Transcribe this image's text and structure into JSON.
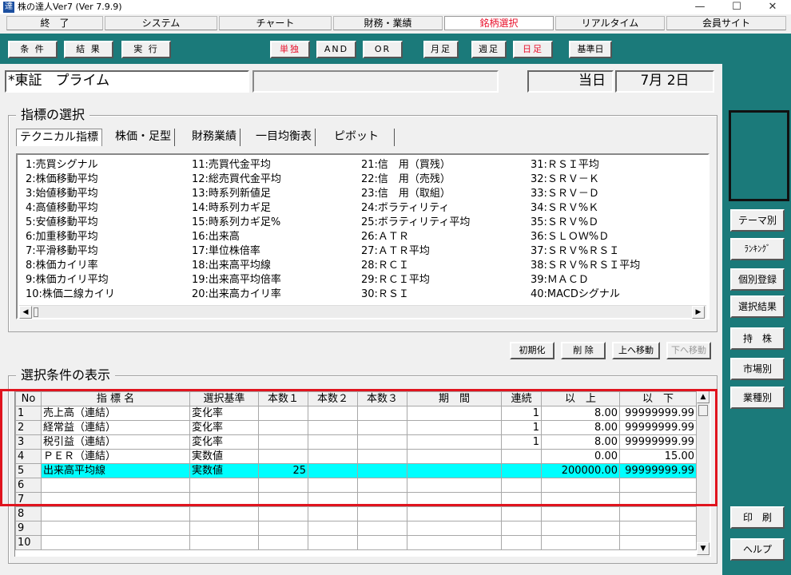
{
  "window": {
    "title": "株の達人Ver7 (Ver 7.9.9)",
    "app_icon_char": "達",
    "controls": [
      "—",
      "☐",
      "✕"
    ]
  },
  "menu": [
    "終　了",
    "システム",
    "チャート",
    "財務・業績",
    "銘柄選択",
    "リアルタイム",
    "会員サイト"
  ],
  "menu_active": "銘柄選択",
  "toolbar": {
    "left_buttons": [
      "条 件",
      "結 果",
      "実 行"
    ],
    "mode_buttons": [
      "単独",
      "AND",
      "OR"
    ],
    "period_buttons": [
      "月足",
      "週足",
      "日足"
    ],
    "base_date_button": "基準日"
  },
  "market": {
    "name": "*東証　プライム",
    "date_label": "当日",
    "date_value": "7月 2日"
  },
  "indicator_section": {
    "title": "指標の選択",
    "tabs": [
      "テクニカル指標",
      "株価・足型",
      "財務業績",
      "一目均衡表",
      "ピボット"
    ],
    "columns": [
      [
        "1:売買シグナル",
        "2:株価移動平均",
        "3:始値移動平均",
        "4:高値移動平均",
        "5:安値移動平均",
        "6:加重移動平均",
        "7:平滑移動平均",
        "8:株価カイリ率",
        "9:株価カイリ平均",
        "10:株価二線カイリ"
      ],
      [
        "11:売買代金平均",
        "12:総売買代金平均",
        "13:時系列新値足",
        "14:時系列カギ足",
        "15:時系列カギ足%",
        "16:出来高",
        "17:単位株倍率",
        "18:出来高平均線",
        "19:出来高平均倍率",
        "20:出来高カイリ率"
      ],
      [
        "21:信　用（買残）",
        "22:信　用（売残）",
        "23:信　用（取組）",
        "24:ボラティリティ",
        "25:ボラティリティ平均",
        "26:ＡＴＲ",
        "27:ＡＴＲ平均",
        "28:ＲＣＩ",
        "29:ＲＣＩ平均",
        "30:ＲＳＩ"
      ],
      [
        "31:ＲＳＩ平均",
        "32:ＳＲＶ－Ｋ",
        "33:ＳＲＶ－Ｄ",
        "34:ＳＲＶ%Ｋ",
        "35:ＳＲＶ%Ｄ",
        "36:ＳＬＯＷ%Ｄ",
        "37:ＳＲＶ%ＲＳＩ",
        "38:ＳＲＶ%ＲＳＩ平均",
        "39:ＭＡＣＤ",
        "40:MACDシグナル"
      ]
    ],
    "actions": [
      "初期化",
      "削 除",
      "上へ移動",
      "下へ移動"
    ]
  },
  "conditions": {
    "title": "選択条件の表示",
    "headers": [
      "No",
      "指 標 名",
      "選択基準",
      "本数１",
      "本数２",
      "本数３",
      "期　間",
      "連続",
      "以　上",
      "以　下"
    ],
    "rows": [
      [
        "1",
        "売上高（連結）",
        "変化率",
        "",
        "",
        "",
        "",
        "1",
        "8.00",
        "99999999.99"
      ],
      [
        "2",
        "経常益（連結）",
        "変化率",
        "",
        "",
        "",
        "",
        "1",
        "8.00",
        "99999999.99"
      ],
      [
        "3",
        "税引益（連結）",
        "変化率",
        "",
        "",
        "",
        "",
        "1",
        "8.00",
        "99999999.99"
      ],
      [
        "4",
        "ＰＥＲ（連結）",
        "実数値",
        "",
        "",
        "",
        "",
        "",
        "0.00",
        "15.00"
      ],
      [
        "5",
        "出来高平均線",
        "実数値",
        "25",
        "",
        "",
        "",
        "",
        "200000.00",
        "99999999.99"
      ],
      [
        "6",
        "",
        "",
        "",
        "",
        "",
        "",
        "",
        "",
        ""
      ],
      [
        "7",
        "",
        "",
        "",
        "",
        "",
        "",
        "",
        "",
        ""
      ],
      [
        "8",
        "",
        "",
        "",
        "",
        "",
        "",
        "",
        "",
        ""
      ],
      [
        "9",
        "",
        "",
        "",
        "",
        "",
        "",
        "",
        "",
        ""
      ],
      [
        "10",
        "",
        "",
        "",
        "",
        "",
        "",
        "",
        "",
        ""
      ]
    ],
    "highlighted_row": 5,
    "highlight_color": "#00ffff"
  },
  "sidebar": {
    "buttons": [
      "テーマ別",
      "ﾗﾝｷﾝｸﾞ",
      "個別登録",
      "選択結果",
      "持　株",
      "市場別",
      "業種別"
    ],
    "bottom_buttons": [
      "印　刷",
      "ヘルプ"
    ]
  },
  "colors": {
    "teal": "#1b7a7a",
    "active_red": "#e8102b",
    "annotation_red": "#e0141e"
  }
}
